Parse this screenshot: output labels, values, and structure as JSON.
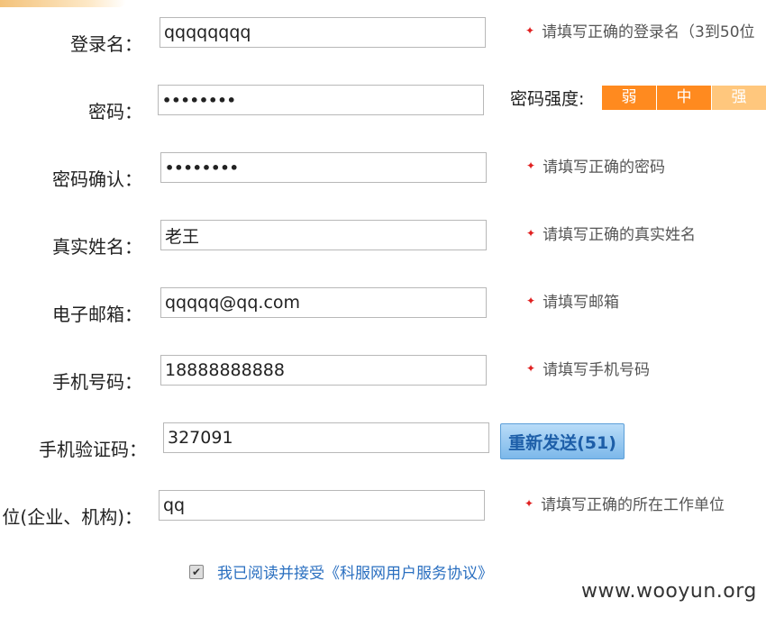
{
  "form": {
    "login": {
      "label": "登录名：",
      "value": "qqqqqqqq",
      "hint": "请填写正确的登录名（3到50位"
    },
    "password": {
      "label": "密码：",
      "value": "••••••••"
    },
    "strength": {
      "label": "密码强度:",
      "levels": [
        "弱",
        "中",
        "强"
      ]
    },
    "confirm": {
      "label": "密码确认：",
      "value": "••••••••",
      "hint": "请填写正确的密码"
    },
    "realname": {
      "label": "真实姓名：",
      "value": "老王",
      "hint": "请填写正确的真实姓名"
    },
    "email": {
      "label": "电子邮箱：",
      "value": "qqqqq@qq.com",
      "hint": "请填写邮箱"
    },
    "phone": {
      "label": "手机号码：",
      "value": "18888888888",
      "hint": "请填写手机号码"
    },
    "sms": {
      "label": "手机验证码：",
      "value": "327091",
      "resend_label": "重新发送(51)"
    },
    "org": {
      "label": "位(企业、机构)：",
      "value": "qq",
      "hint": "请填写正确的所在工作单位"
    },
    "agreement": {
      "checked": true,
      "text": "我已阅读并接受《科服网用户服务协议》"
    }
  },
  "watermark": "www.wooyun.org",
  "colors": {
    "required_star": "#e02020",
    "strength_active": "#ff8a1f",
    "strength_inactive": "#ffc77d",
    "link": "#2a6fc0"
  }
}
